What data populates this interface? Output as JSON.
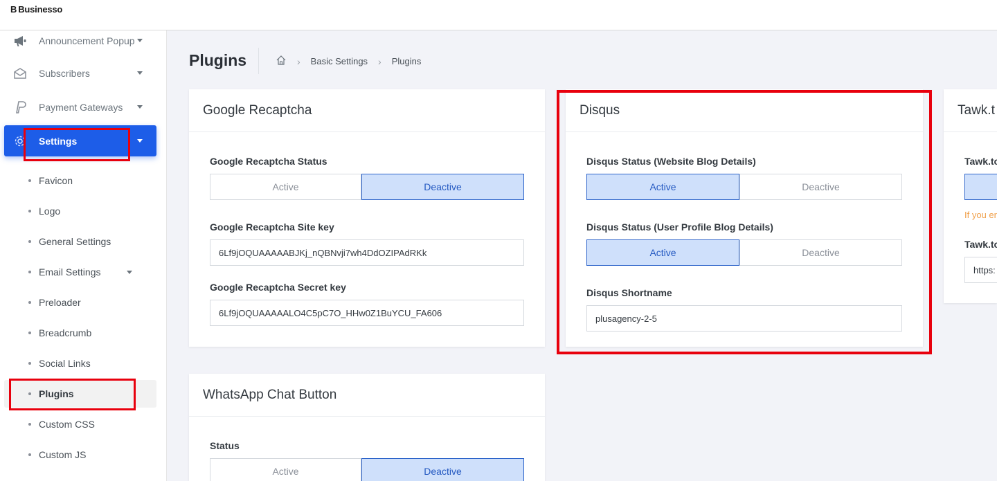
{
  "brand": {
    "mark": "B",
    "name": "Businesso"
  },
  "sidebar": {
    "items": [
      {
        "label": "Announcement Popup",
        "icon": "megaphone-icon"
      },
      {
        "label": "Subscribers",
        "icon": "envelope-icon"
      },
      {
        "label": "Payment Gateways",
        "icon": "paypal-icon"
      },
      {
        "label": "Settings",
        "icon": "gear-icon"
      }
    ],
    "sub_items": [
      {
        "label": "Favicon"
      },
      {
        "label": "Logo"
      },
      {
        "label": "General Settings"
      },
      {
        "label": "Email Settings"
      },
      {
        "label": "Preloader"
      },
      {
        "label": "Breadcrumb"
      },
      {
        "label": "Social Links"
      },
      {
        "label": "Plugins"
      },
      {
        "label": "Custom CSS"
      },
      {
        "label": "Custom JS"
      }
    ]
  },
  "header": {
    "title": "Plugins",
    "breadcrumb": [
      "Basic Settings",
      "Plugins"
    ]
  },
  "cards": {
    "recaptcha": {
      "title": "Google Recaptcha",
      "status_label": "Google Recaptcha Status",
      "active": "Active",
      "deactive": "Deactive",
      "site_key_label": "Google Recaptcha Site key",
      "site_key": "6Lf9jOQUAAAAABJKj_nQBNvji7wh4DdOZIPAdRKk",
      "secret_key_label": "Google Recaptcha Secret key",
      "secret_key": "6Lf9jOQUAAAAALO4C5pC7O_HHw0Z1BuYCU_FA606"
    },
    "disqus": {
      "title": "Disqus",
      "status_blog_label": "Disqus Status (Website Blog Details)",
      "status_profile_label": "Disqus Status (User Profile Blog Details)",
      "active": "Active",
      "deactive": "Deactive",
      "shortname_label": "Disqus Shortname",
      "shortname": "plusagency-2-5"
    },
    "tawk": {
      "title": "Tawk.t",
      "status_label": "Tawk.to",
      "hint": "If you er",
      "url_label": "Tawk.to",
      "url": "https:"
    },
    "whatsapp": {
      "title": "WhatsApp Chat Button",
      "status_label": "Status",
      "active": "Active",
      "deactive": "Deactive"
    }
  },
  "colors": {
    "accent": "#1d5de8",
    "selected_bg": "#cfe0fb",
    "highlight": "#e8000d",
    "hint": "#f0a04b"
  }
}
